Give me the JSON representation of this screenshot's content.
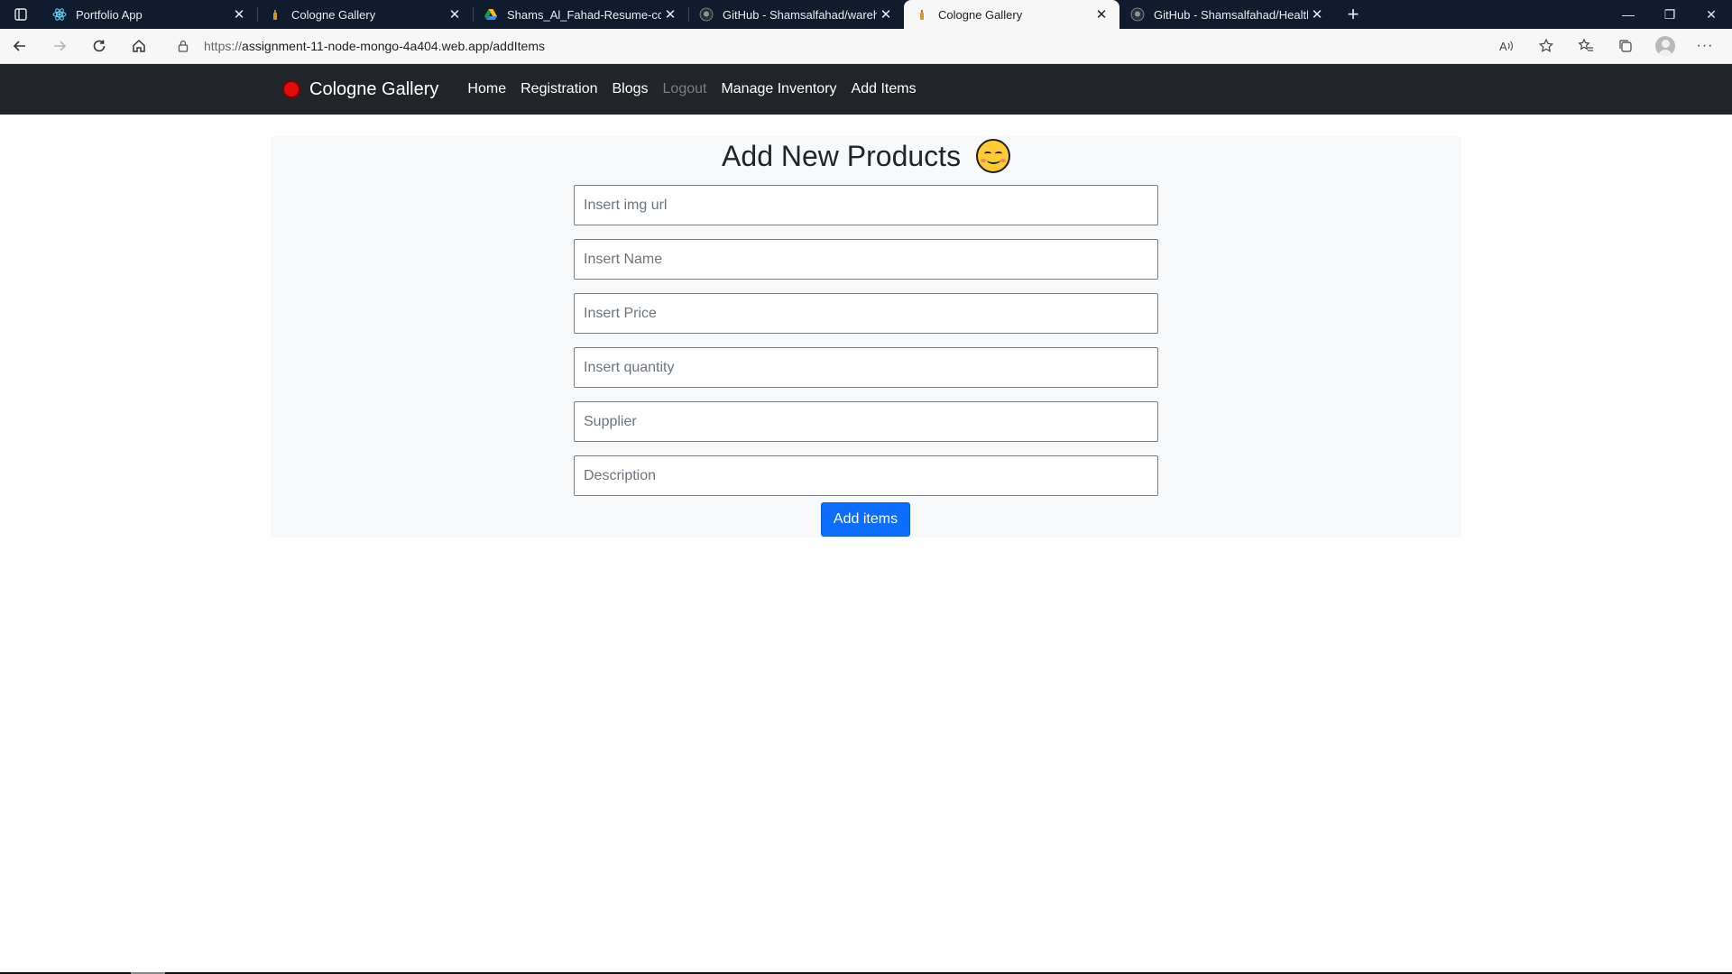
{
  "browser": {
    "tabs": [
      {
        "title": "Portfolio App",
        "icon": "react-icon",
        "active": false
      },
      {
        "title": "Cologne Gallery",
        "icon": "bottle-icon",
        "active": false
      },
      {
        "title": "Shams_Al_Fahad-Resume-conver",
        "icon": "drive-icon",
        "active": false
      },
      {
        "title": "GitHub - Shamsalfahad/warehou",
        "icon": "github-icon",
        "active": false
      },
      {
        "title": "Cologne Gallery",
        "icon": "bottle-icon",
        "active": true
      },
      {
        "title": "GitHub - Shamsalfahad/Health_C",
        "icon": "github-icon",
        "active": false
      }
    ],
    "url_prefix": "https://",
    "url_rest": "assignment-11-node-mongo-4a404.web.app/addItems"
  },
  "site": {
    "brand": "Cologne Gallery",
    "nav": {
      "home": "Home",
      "registration": "Registration",
      "blogs": "Blogs",
      "logout": "Logout",
      "manage_inventory": "Manage Inventory",
      "add_items": "Add Items"
    }
  },
  "form": {
    "heading": "Add New Products",
    "heading_emoji": "smiling-face-icon",
    "img_url_placeholder": "Insert img url",
    "name_placeholder": "Insert Name",
    "price_placeholder": "Insert Price",
    "quantity_placeholder": "Insert quantity",
    "supplier_placeholder": "Supplier",
    "description_placeholder": "Description",
    "submit_label": "Add items"
  },
  "colors": {
    "navbar_bg": "#212529",
    "primary_button": "#0d6efd",
    "panel_bg": "#f8f9fa",
    "tabstrip_bg": "#0f1c2e"
  }
}
